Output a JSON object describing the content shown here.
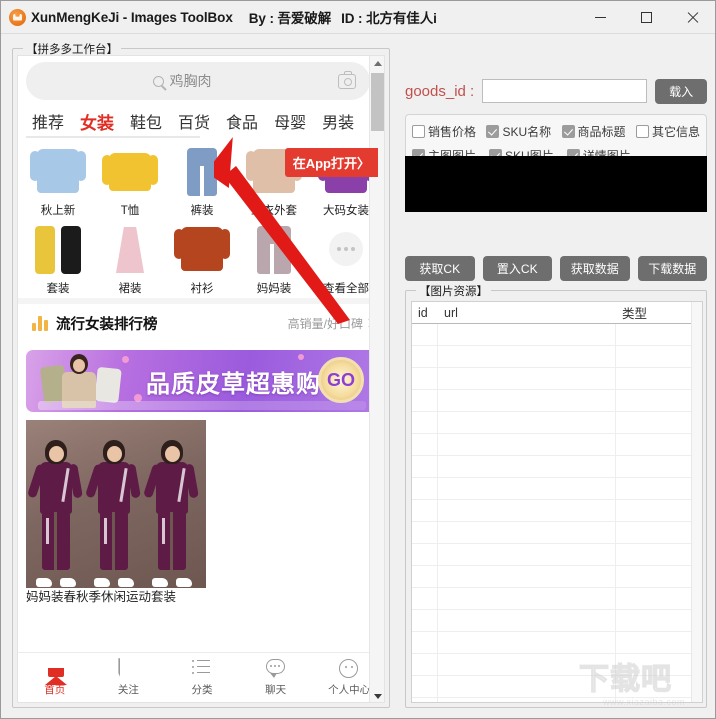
{
  "titlebar": {
    "app_name": "XunMengKeJi - Images ToolBox",
    "by": "By : 吾爱破解",
    "id": "ID : 北方有佳人i",
    "icon": "app-logo-icon",
    "minimize": "minimize-icon",
    "maximize": "maximize-icon",
    "close": "close-icon"
  },
  "left_panel": {
    "group_title": "【拼多多工作台】",
    "search": {
      "value": "鸡胸肉",
      "placeholder": "鸡胸肉",
      "search_icon": "search-icon",
      "camera_icon": "camera-icon"
    },
    "tabs": [
      {
        "label": "推荐",
        "active": false
      },
      {
        "label": "女装",
        "active": true
      },
      {
        "label": "鞋包",
        "active": false
      },
      {
        "label": "百货",
        "active": false
      },
      {
        "label": "食品",
        "active": false
      },
      {
        "label": "母婴",
        "active": false
      },
      {
        "label": "男装",
        "active": false
      }
    ],
    "app_open_badge": "在App打开〉",
    "categories": [
      {
        "label": "秋上新",
        "color": "#a8c8e8",
        "shape": "top"
      },
      {
        "label": "T恤",
        "color": "#f2c331",
        "shape": "top"
      },
      {
        "label": "裤装",
        "color": "#7f9cc4",
        "shape": "pants"
      },
      {
        "label": "上衣外套",
        "color": "#e0bfa8",
        "shape": "top"
      },
      {
        "label": "大码女装",
        "color": "#8b3fa8",
        "shape": "top"
      },
      {
        "label": "套装",
        "color": "#e8c53a",
        "shape": "split"
      },
      {
        "label": "裙装",
        "color": "#eec5cd",
        "shape": "dress"
      },
      {
        "label": "衬衫",
        "color": "#b4451f",
        "shape": "top"
      },
      {
        "label": "妈妈装",
        "color": "#b9a7ad",
        "shape": "pants"
      },
      {
        "label": "查看全部",
        "color": "#c4c4c4",
        "shape": "dots"
      }
    ],
    "rank": {
      "title": "流行女装排行榜",
      "subtitle": "高销量/好口碑",
      "bars_icon": "bar-chart-icon",
      "chevron_icon": "chevron-right-icon"
    },
    "banner": {
      "text": "品质皮草超惠购",
      "go_label": "GO"
    },
    "product": {
      "title": "妈妈装春秋季休闲运动套装"
    },
    "bottom_nav": [
      {
        "label": "首页",
        "icon": "home-icon",
        "active": true
      },
      {
        "label": "关注",
        "icon": "plus-tag-icon",
        "active": false
      },
      {
        "label": "分类",
        "icon": "list-icon",
        "active": false
      },
      {
        "label": "聊天",
        "icon": "chat-icon",
        "active": false
      },
      {
        "label": "个人中心",
        "icon": "user-icon",
        "active": false
      }
    ],
    "scrollbar": {
      "up_icon": "scroll-up-arrow-icon",
      "down_icon": "scroll-down-arrow-icon"
    }
  },
  "right_panel": {
    "goods_id_label": "goods_id :",
    "goods_id_value": "",
    "goods_id_placeholder": "",
    "load_button": "载入",
    "options": [
      {
        "label": "销售价格",
        "checked": false
      },
      {
        "label": "SKU名称",
        "checked": true
      },
      {
        "label": "商品标题",
        "checked": true
      },
      {
        "label": "其它信息",
        "checked": false
      },
      {
        "label": "主图图片",
        "checked": true
      },
      {
        "label": "SKU图片",
        "checked": true
      },
      {
        "label": "详情图片",
        "checked": true
      }
    ],
    "log_text": "",
    "action_buttons": [
      {
        "label": "获取CK"
      },
      {
        "label": "置入CK"
      },
      {
        "label": "获取数据"
      },
      {
        "label": "下载数据"
      }
    ],
    "resources": {
      "group_title": "【图片资源】",
      "columns": [
        "id",
        "url",
        "类型"
      ],
      "rows": []
    }
  },
  "watermark": {
    "logo": "下载吧",
    "url": "www.xiazaiba.com"
  },
  "colors": {
    "accent_red": "#e02e24",
    "label_red": "#c0504d",
    "button_gray": "#6e6e6e",
    "banner_purple": "#9b5bdd"
  }
}
